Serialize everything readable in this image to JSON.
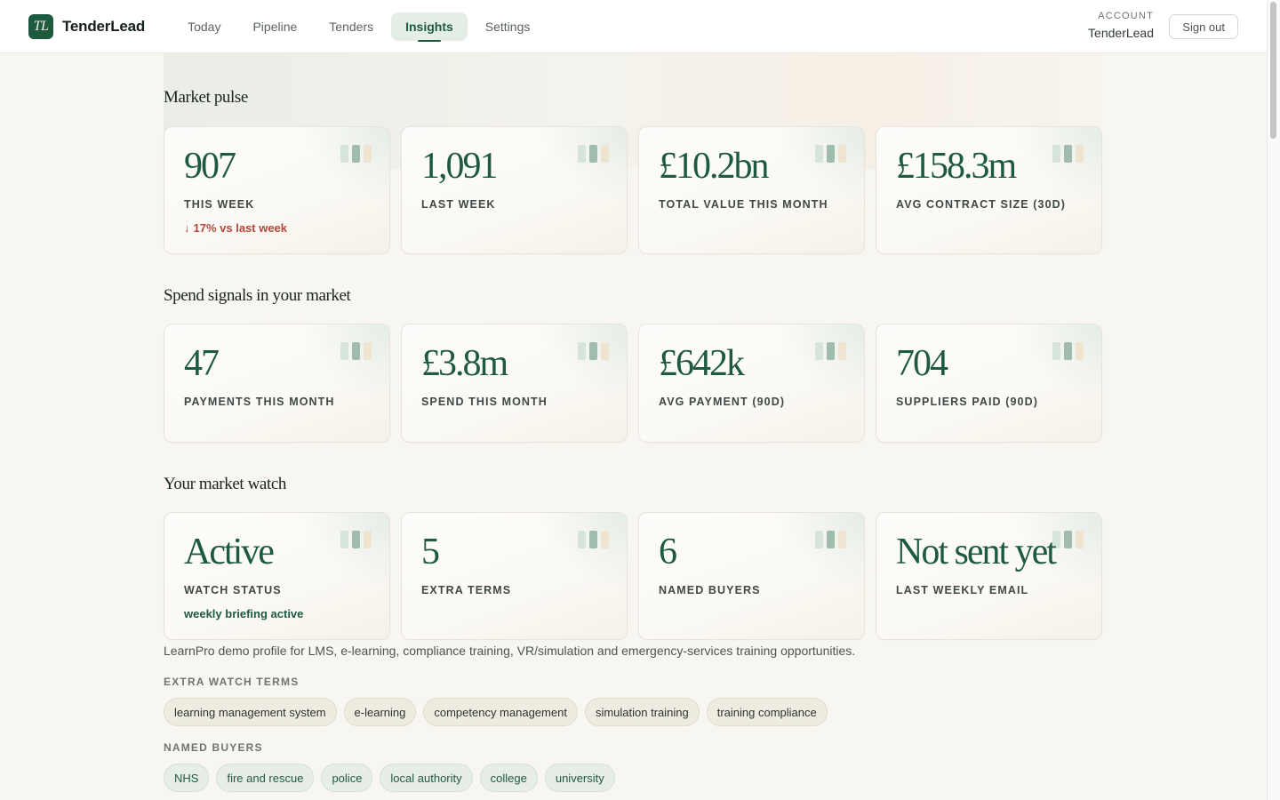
{
  "header": {
    "logo_text": "TL",
    "brand": "TenderLead",
    "nav": [
      {
        "label": "Today",
        "active": false
      },
      {
        "label": "Pipeline",
        "active": false
      },
      {
        "label": "Tenders",
        "active": false
      },
      {
        "label": "Insights",
        "active": true
      },
      {
        "label": "Settings",
        "active": false
      }
    ],
    "account_label": "ACCOUNT",
    "account_name": "TenderLead",
    "sign_out": "Sign out"
  },
  "sections": {
    "market_pulse": {
      "title": "Market pulse",
      "cards": [
        {
          "value": "907",
          "label": "THIS WEEK",
          "delta": "17% vs last week",
          "delta_direction": "down"
        },
        {
          "value": "1,091",
          "label": "LAST WEEK"
        },
        {
          "value": "£10.2bn",
          "label": "TOTAL VALUE THIS MONTH"
        },
        {
          "value": "£158.3m",
          "label": "AVG CONTRACT SIZE (30D)"
        }
      ]
    },
    "spend_signals": {
      "title": "Spend signals in your market",
      "cards": [
        {
          "value": "47",
          "label": "PAYMENTS THIS MONTH"
        },
        {
          "value": "£3.8m",
          "label": "SPEND THIS MONTH"
        },
        {
          "value": "£642k",
          "label": "AVG PAYMENT (90D)"
        },
        {
          "value": "704",
          "label": "SUPPLIERS PAID (90D)"
        }
      ]
    },
    "market_watch": {
      "title": "Your market watch",
      "cards": [
        {
          "value": "Active",
          "label": "WATCH STATUS",
          "note": "weekly briefing active"
        },
        {
          "value": "5",
          "label": "EXTRA TERMS"
        },
        {
          "value": "6",
          "label": "NAMED BUYERS"
        },
        {
          "value": "Not sent yet",
          "label": "LAST WEEKLY EMAIL"
        }
      ],
      "description": "LearnPro demo profile for LMS, e-learning, compliance training, VR/simulation and emergency-services training opportunities.",
      "extra_terms_label": "EXTRA WATCH TERMS",
      "extra_terms": [
        "learning management system",
        "e-learning",
        "competency management",
        "simulation training",
        "training compliance"
      ],
      "named_buyers_label": "NAMED BUYERS",
      "named_buyers": [
        "NHS",
        "fire and rescue",
        "police",
        "local authority",
        "college",
        "university"
      ]
    }
  },
  "colors": {
    "brand_green": "#1e5a3f",
    "negative_red": "#b5463a",
    "background": "#f8f6f1"
  }
}
